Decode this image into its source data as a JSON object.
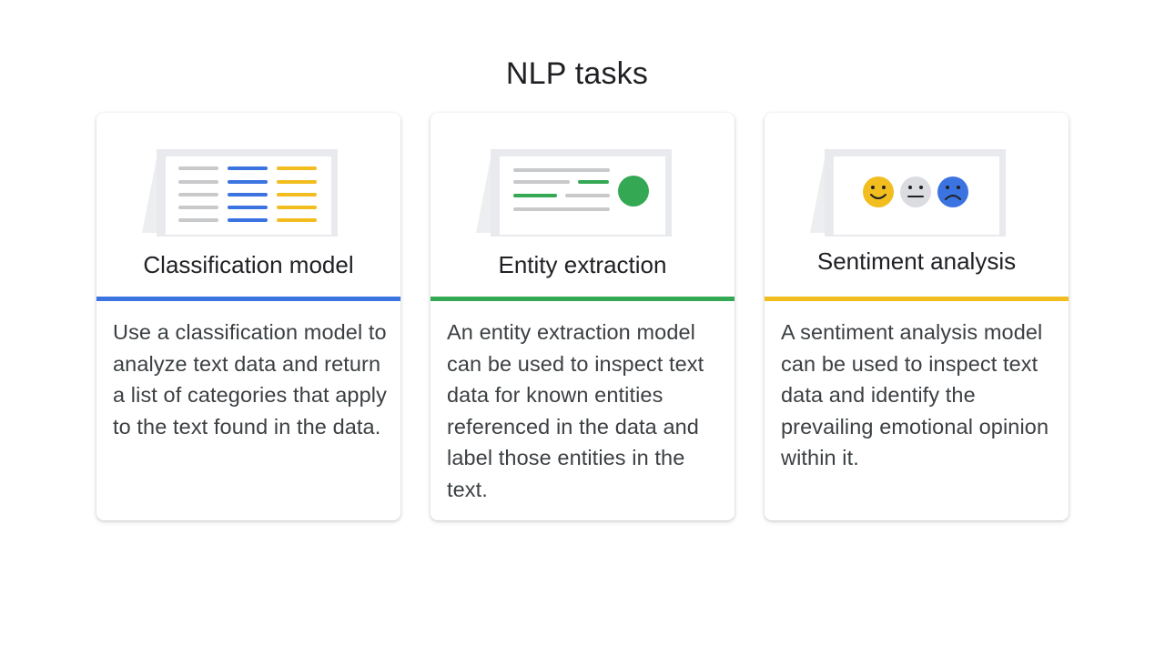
{
  "slide": {
    "title": "NLP tasks"
  },
  "colors": {
    "blue": "#3b73e0",
    "green": "#34a853",
    "yellow": "#f2bd1f",
    "gray_line": "#c8c9cb",
    "paper": "#f1f3f4"
  },
  "cards": [
    {
      "heading": "Classification model",
      "accent_color": "#3b73e0",
      "icon": "document-categories-icon",
      "body": "Use a classification model to analyze text data and return a list of categories that apply to the text found in the data."
    },
    {
      "heading": "Entity extraction",
      "accent_color": "#34a853",
      "icon": "document-entity-icon",
      "body": "An entity extraction model can be used to inspect text data for known entities referenced in the data and label those entities in the text."
    },
    {
      "heading": "Sentiment analysis",
      "accent_color": "#f2bd1f",
      "icon": "sentiment-faces-icon",
      "body": "A sentiment analysis model can be used to inspect text data and identify the prevailing emotional opinion within it."
    }
  ]
}
